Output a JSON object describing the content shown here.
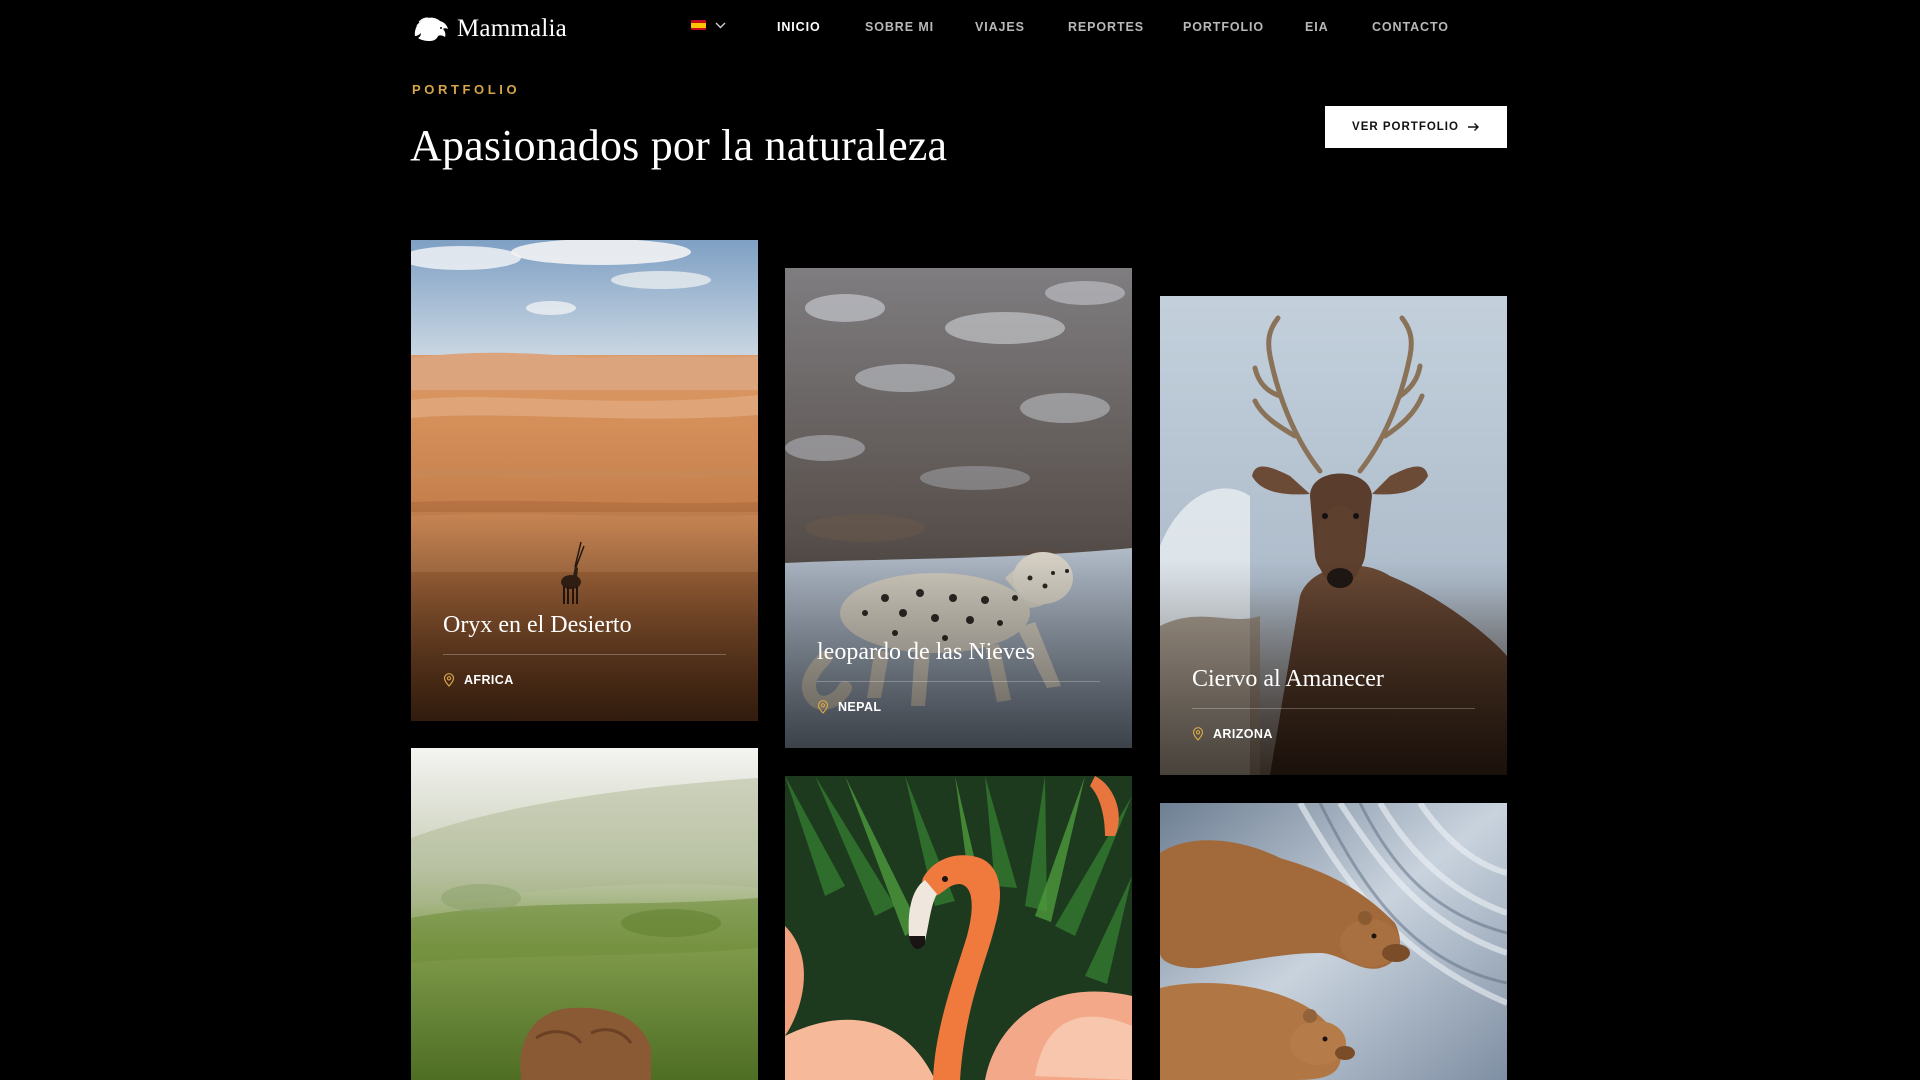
{
  "brand": {
    "name": "Mammalia",
    "logo_icon": "lion-head-icon"
  },
  "language": {
    "flag": "spain-flag-icon",
    "dropdown_icon": "chevron-down-icon"
  },
  "nav": {
    "items": [
      {
        "label": "INICIO",
        "active": true
      },
      {
        "label": "SOBRE MI",
        "active": false
      },
      {
        "label": "VIAJES",
        "active": false
      },
      {
        "label": "REPORTES",
        "active": false
      },
      {
        "label": "PORTFOLIO",
        "active": false
      },
      {
        "label": "EIA",
        "active": false
      },
      {
        "label": "CONTACTO",
        "active": false
      }
    ]
  },
  "section": {
    "eyebrow": "PORTFOLIO",
    "title": "Apasionados por la naturaleza",
    "cta_label": "VER PORTFOLIO",
    "cta_icon": "arrow-right-icon"
  },
  "cards": [
    {
      "title": "Oryx en el Desierto",
      "location": "AFRICA",
      "location_icon": "map-pin-icon"
    },
    {
      "title": "leopardo de las Nieves",
      "location": "NEPAL",
      "location_icon": "map-pin-icon"
    },
    {
      "title": "Ciervo al Amanecer",
      "location": "ARIZONA",
      "location_icon": "map-pin-icon"
    }
  ],
  "colors": {
    "background": "#000000",
    "accent_gold": "#d6a548",
    "nav_active": "#ffffff",
    "nav_inactive": "#b8b8b8",
    "button_bg": "#ffffff"
  }
}
